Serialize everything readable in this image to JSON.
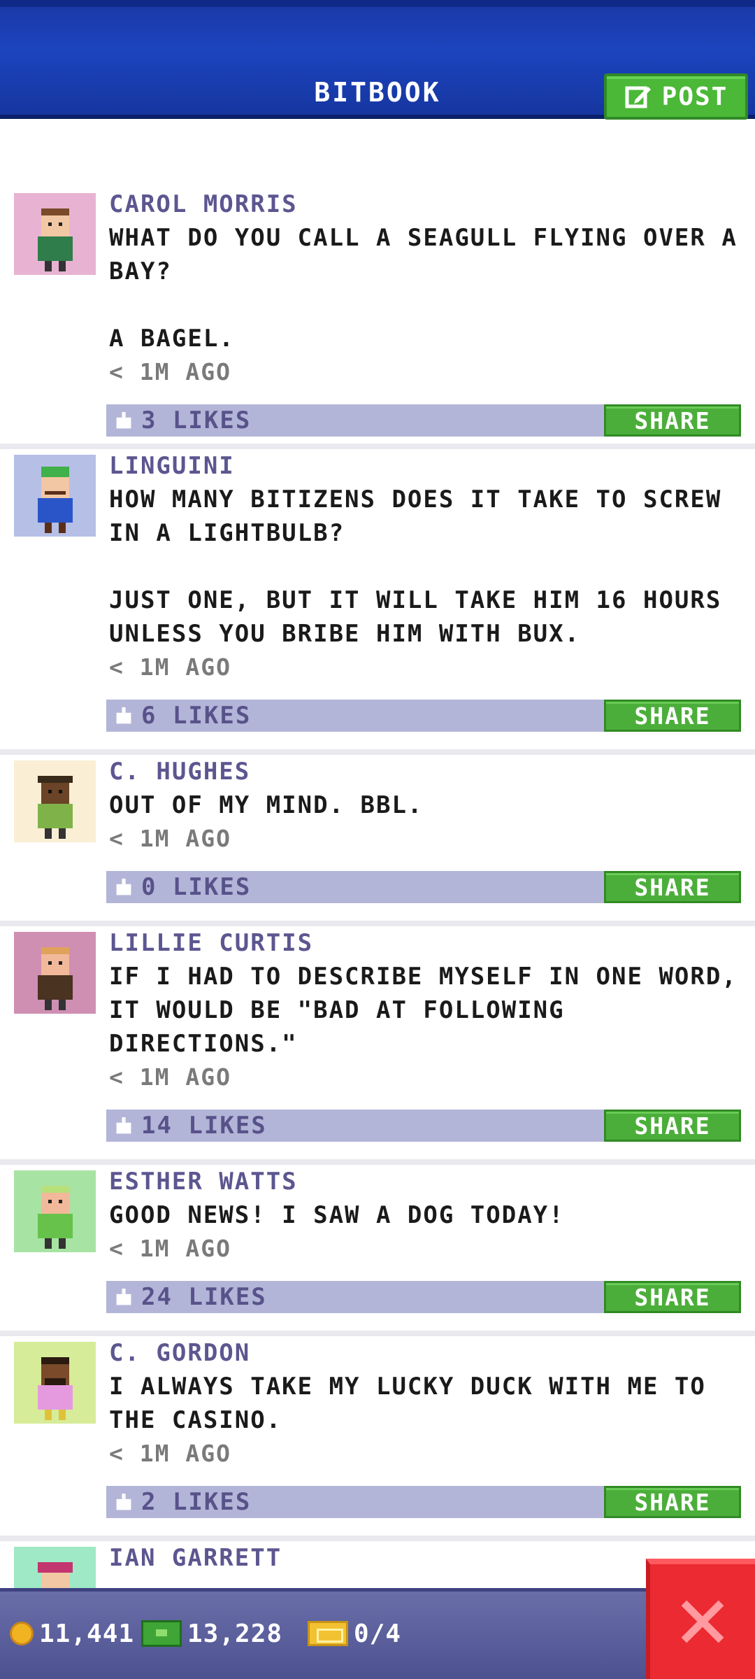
{
  "header": {
    "title": "BITBOOK",
    "post_label": "POST"
  },
  "posts": [
    {
      "author": "CAROL MORRIS",
      "message": "WHAT DO YOU CALL A SEAGULL FLYING OVER A BAY?\n\nA BAGEL.",
      "time": "< 1M AGO",
      "likes": "3 LIKES",
      "share": "SHARE",
      "avatar_bg": "#e8b3d3"
    },
    {
      "author": "LINGUINI",
      "message": "HOW MANY BITIZENS DOES IT TAKE TO SCREW IN A LIGHTBULB?\n\nJUST ONE, BUT IT WILL TAKE HIM 16 HOURS UNLESS YOU BRIBE HIM WITH BUX.",
      "time": "< 1M AGO",
      "likes": "6 LIKES",
      "share": "SHARE",
      "avatar_bg": "#b6bfe6"
    },
    {
      "author": "C. HUGHES",
      "message": "OUT OF MY MIND. BBL.",
      "time": "< 1M AGO",
      "likes": "0 LIKES",
      "share": "SHARE",
      "avatar_bg": "#faefd4"
    },
    {
      "author": "LILLIE CURTIS",
      "message": "IF I HAD TO DESCRIBE MYSELF IN ONE WORD, IT WOULD BE \"BAD AT FOLLOWING DIRECTIONS.\"",
      "time": "< 1M AGO",
      "likes": "14 LIKES",
      "share": "SHARE",
      "avatar_bg": "#cf8fb3"
    },
    {
      "author": "ESTHER WATTS",
      "message": "GOOD NEWS! I SAW A DOG TODAY!",
      "time": "< 1M AGO",
      "likes": "24 LIKES",
      "share": "SHARE",
      "avatar_bg": "#a7e3a3"
    },
    {
      "author": "C. GORDON",
      "message": "I ALWAYS TAKE MY LUCKY DUCK WITH ME TO THE CASINO.",
      "time": "< 1M AGO",
      "likes": "2 LIKES",
      "share": "SHARE",
      "avatar_bg": "#d7ec99"
    },
    {
      "author": "IAN GARRETT",
      "avatar_bg": "#9fe9c7"
    }
  ],
  "bottom_bar": {
    "coins": "11,441",
    "bux": "13,228",
    "tickets": "0/4"
  },
  "colors": {
    "header_blue": "#1c44be",
    "share_green": "#4cae3a",
    "likes_bar": "#b3b5d8",
    "close_red": "#ec2a31"
  },
  "icons": {
    "post": "edit-icon",
    "like": "thumbs-up-icon",
    "coin": "coin-icon",
    "bux": "bux-icon",
    "ticket": "ticket-icon",
    "close": "close-icon"
  }
}
